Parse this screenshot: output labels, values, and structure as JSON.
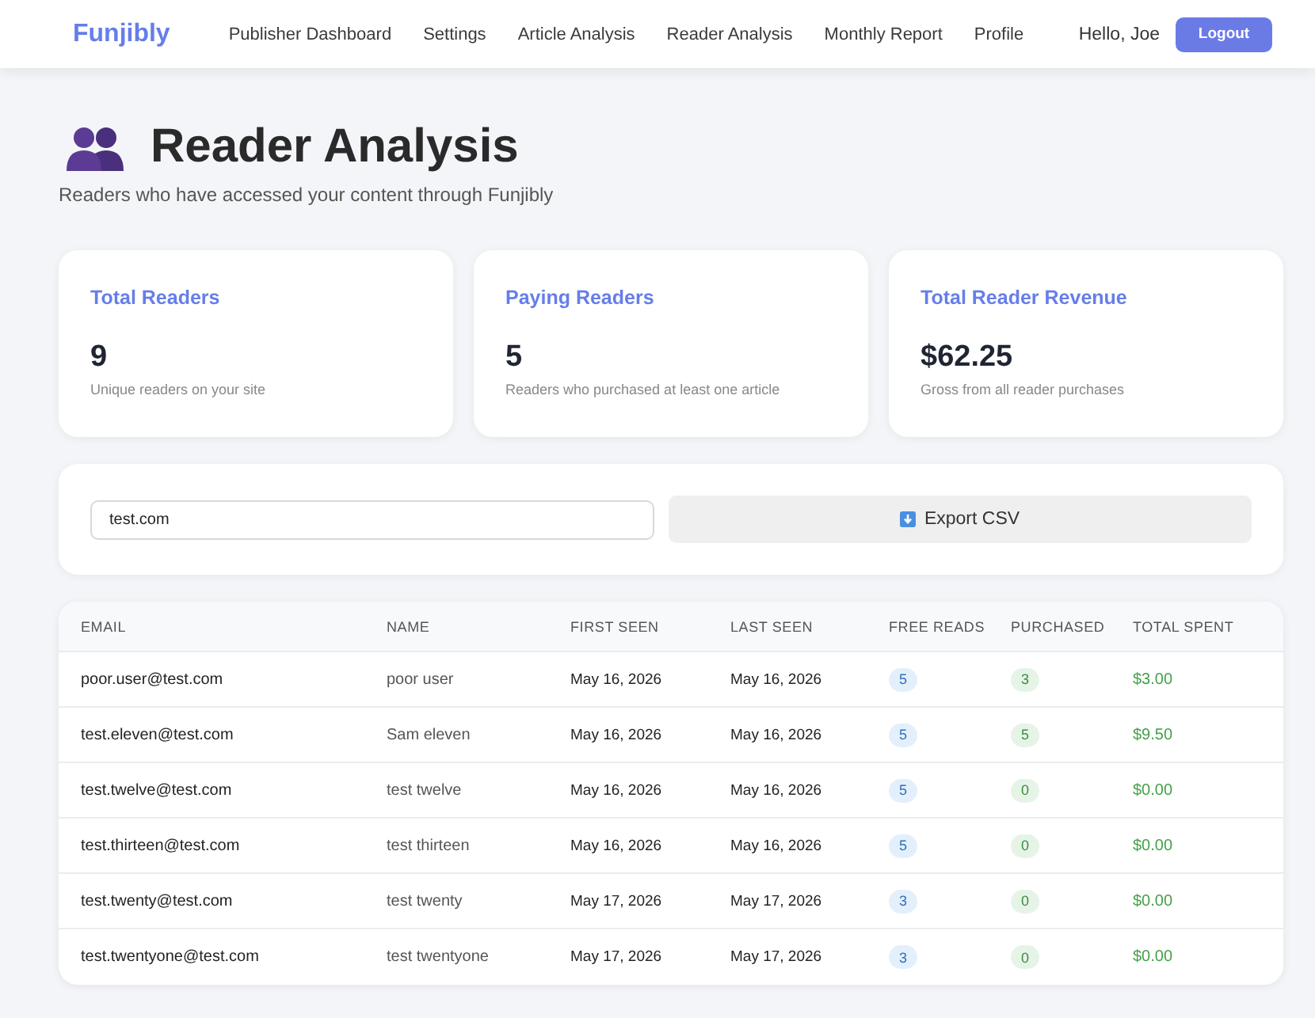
{
  "nav": {
    "brand": "Funjibly",
    "links": [
      "Publisher Dashboard",
      "Settings",
      "Article Analysis",
      "Reader Analysis",
      "Monthly Report",
      "Profile"
    ],
    "greeting": "Hello, Joe",
    "logout": "Logout"
  },
  "header": {
    "title": "Reader Analysis",
    "subtitle": "Readers who have accessed your content through Funjibly"
  },
  "stats": [
    {
      "title": "Total Readers",
      "value": "9",
      "description": "Unique readers on your site"
    },
    {
      "title": "Paying Readers",
      "value": "5",
      "description": "Readers who purchased at least one article"
    },
    {
      "title": "Total Reader Revenue",
      "value": "$62.25",
      "description": "Gross from all reader purchases"
    }
  ],
  "filter": {
    "search_value": "test.com",
    "export_label": "Export CSV"
  },
  "table": {
    "columns": [
      "EMAIL",
      "NAME",
      "FIRST SEEN",
      "LAST SEEN",
      "FREE READS",
      "PURCHASED",
      "TOTAL SPENT"
    ],
    "rows": [
      {
        "email": "poor.user@test.com",
        "name": "poor user",
        "first_seen": "May 16, 2026",
        "last_seen": "May 16, 2026",
        "free_reads": "5",
        "purchased": "3",
        "total_spent": "$3.00"
      },
      {
        "email": "test.eleven@test.com",
        "name": "Sam eleven",
        "first_seen": "May 16, 2026",
        "last_seen": "May 16, 2026",
        "free_reads": "5",
        "purchased": "5",
        "total_spent": "$9.50"
      },
      {
        "email": "test.twelve@test.com",
        "name": "test twelve",
        "first_seen": "May 16, 2026",
        "last_seen": "May 16, 2026",
        "free_reads": "5",
        "purchased": "0",
        "total_spent": "$0.00"
      },
      {
        "email": "test.thirteen@test.com",
        "name": "test thirteen",
        "first_seen": "May 16, 2026",
        "last_seen": "May 16, 2026",
        "free_reads": "5",
        "purchased": "0",
        "total_spent": "$0.00"
      },
      {
        "email": "test.twenty@test.com",
        "name": "test twenty",
        "first_seen": "May 17, 2026",
        "last_seen": "May 17, 2026",
        "free_reads": "3",
        "purchased": "0",
        "total_spent": "$0.00"
      },
      {
        "email": "test.twentyone@test.com",
        "name": "test twentyone",
        "first_seen": "May 17, 2026",
        "last_seen": "May 17, 2026",
        "free_reads": "3",
        "purchased": "0",
        "total_spent": "$0.00"
      }
    ]
  }
}
